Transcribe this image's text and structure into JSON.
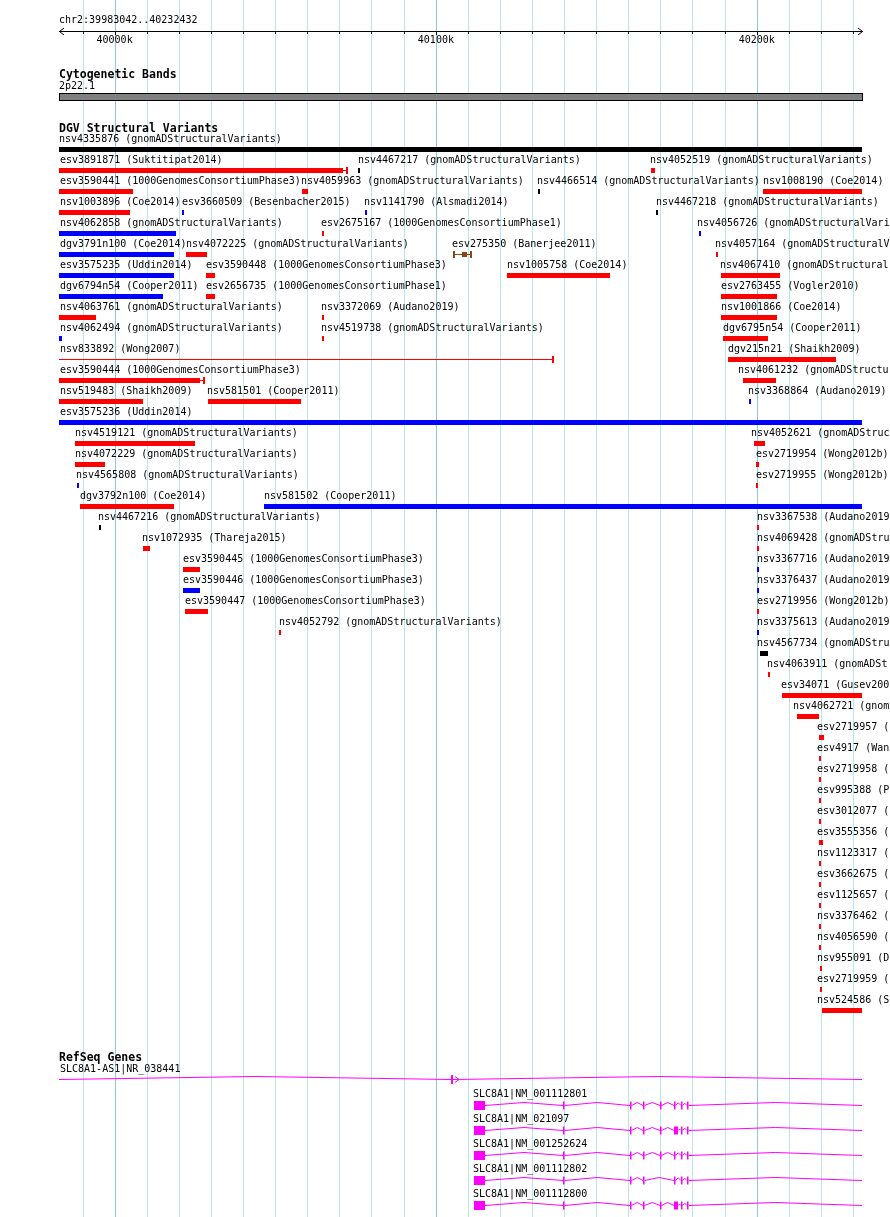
{
  "ruler": {
    "locus": "chr2:39983042..40232432",
    "ticks": [
      "40000k",
      "40100k",
      "40200k"
    ]
  },
  "cytoband_track": {
    "title": "Cytogenetic Bands",
    "band": "2p22.1"
  },
  "dgv_track": {
    "title": "DGV Structural Variants",
    "rows": [
      {
        "features": [
          {
            "label": "nsv4335876 (gnomADStructuralVariants)",
            "color": "#000000",
            "kind": "bar"
          }
        ]
      },
      {
        "features": [
          {
            "label": "esv3891871 (Suktitipat2014)",
            "color": "#ff0000",
            "kind": "bar-capped"
          },
          {
            "label": "nsv4467217 (gnomADStructuralVariants)",
            "color": "#000000",
            "kind": "bar"
          },
          {
            "label": "nsv4052519 (gnomADStructuralVariants)",
            "color": "#ff0000",
            "kind": "bar"
          }
        ]
      },
      {
        "features": [
          {
            "label": "esv3590441 (1000GenomesConsortiumPhase3)",
            "color": "#ff0000",
            "kind": "bar"
          },
          {
            "label": "nsv4059963 (gnomADStructuralVariants)",
            "color": "#ff0000",
            "kind": "bar"
          },
          {
            "label": "nsv4466514 (gnomADStructuralVariants)",
            "color": "#000000",
            "kind": "bar"
          },
          {
            "label": "nsv1008190 (Coe2014)",
            "color": "#ff0000",
            "kind": "bar"
          }
        ]
      },
      {
        "features": [
          {
            "label": "nsv1003896 (Coe2014)",
            "color": "#ff0000",
            "kind": "bar"
          },
          {
            "label": "esv3660509 (Besenbacher2015)",
            "color": "#0000ff",
            "kind": "bar"
          },
          {
            "label": "nsv1141790 (Alsmadi2014)",
            "color": "#0000ff",
            "kind": "bar"
          },
          {
            "label": "nsv4467218 (gnomADStructuralVariants)",
            "color": "#000000",
            "kind": "bar"
          }
        ]
      },
      {
        "features": [
          {
            "label": "nsv4062858 (gnomADStructuralVariants)",
            "color": "#0000ff",
            "kind": "bar"
          },
          {
            "label": "esv2675167 (1000GenomesConsortiumPhase1)",
            "color": "#ff0000",
            "kind": "bar"
          },
          {
            "label": "nsv4056726 (gnomADStructuralVari",
            "color": "#0000ff",
            "kind": "bar"
          }
        ]
      },
      {
        "features": [
          {
            "label": "dgv3791n100 (Coe2014)",
            "color": "#0000ff",
            "kind": "bar"
          },
          {
            "label": "nsv4072225 (gnomADStructuralVariants)",
            "color": "#ff0000",
            "kind": "bar"
          },
          {
            "label": "esv275350 (Banerjee2011)",
            "color": "#8b4513",
            "kind": "span-capped"
          },
          {
            "label": "nsv4057164 (gnomADStructuralV",
            "color": "#ff0000",
            "kind": "bar"
          }
        ]
      },
      {
        "features": [
          {
            "label": "esv3575235 (Uddin2014)",
            "color": "#0000ff",
            "kind": "bar"
          },
          {
            "label": "esv3590448 (1000GenomesConsortiumPhase3)",
            "color": "#ff0000",
            "kind": "bar"
          },
          {
            "label": "nsv1005758 (Coe2014)",
            "color": "#ff0000",
            "kind": "bar"
          },
          {
            "label": "nsv4067410 (gnomADStructural",
            "color": "#ff0000",
            "kind": "bar"
          }
        ]
      },
      {
        "features": [
          {
            "label": "dgv6794n54 (Cooper2011)",
            "color": "#0000ff",
            "kind": "bar"
          },
          {
            "label": "esv2656735 (1000GenomesConsortiumPhase1)",
            "color": "#ff0000",
            "kind": "bar"
          },
          {
            "label": "esv2763455 (Vogler2010)",
            "color": "#ff0000",
            "kind": "bar"
          }
        ]
      },
      {
        "features": [
          {
            "label": "nsv4063761 (gnomADStructuralVariants)",
            "color": "#ff0000",
            "kind": "bar"
          },
          {
            "label": "nsv3372069 (Audano2019)",
            "color": "#ff0000",
            "kind": "bar"
          },
          {
            "label": "nsv1001866 (Coe2014)",
            "color": "#ff0000",
            "kind": "bar"
          }
        ]
      },
      {
        "features": [
          {
            "label": "nsv4062494 (gnomADStructuralVariants)",
            "color": "#0000ff",
            "kind": "bar"
          },
          {
            "label": "nsv4519738 (gnomADStructuralVariants)",
            "color": "#ff0000",
            "kind": "bar"
          },
          {
            "label": "dgv6795n54 (Cooper2011)",
            "color": "#ff0000",
            "kind": "bar"
          }
        ]
      },
      {
        "features": [
          {
            "label": "nsv833892 (Wong2007)",
            "color": "#ff0000",
            "kind": "line-capped"
          },
          {
            "label": "dgv215n21 (Shaikh2009)",
            "color": "#ff0000",
            "kind": "bar"
          }
        ]
      },
      {
        "features": [
          {
            "label": "esv3590444 (1000GenomesConsortiumPhase3)",
            "color": "#ff0000",
            "kind": "bar-capped"
          },
          {
            "label": "nsv4061232 (gnomADStructu",
            "color": "#ff0000",
            "kind": "bar"
          }
        ]
      },
      {
        "features": [
          {
            "label": "nsv519483 (Shaikh2009)",
            "color": "#ff0000",
            "kind": "bar"
          },
          {
            "label": "nsv581501 (Cooper2011)",
            "color": "#ff0000",
            "kind": "bar"
          },
          {
            "label": "nsv3368864 (Audano2019)",
            "color": "#0000ff",
            "kind": "bar"
          }
        ]
      },
      {
        "features": [
          {
            "label": "esv3575236 (Uddin2014)",
            "color": "#0000ff",
            "kind": "bar"
          }
        ]
      },
      {
        "features": [
          {
            "label": "nsv4519121 (gnomADStructuralVariants)",
            "color": "#ff0000",
            "kind": "bar"
          },
          {
            "label": "nsv4052621 (gnomADStruc",
            "color": "#ff0000",
            "kind": "bar"
          }
        ]
      },
      {
        "features": [
          {
            "label": "nsv4072229 (gnomADStructuralVariants)",
            "color": "#ff0000",
            "kind": "bar"
          },
          {
            "label": "esv2719954 (Wong2012b)",
            "color": "#ff0000",
            "kind": "bar"
          }
        ]
      },
      {
        "features": [
          {
            "label": "nsv4565808 (gnomADStructuralVariants)",
            "color": "#0000ff",
            "kind": "bar"
          },
          {
            "label": "esv2719955 (Wong2012b)",
            "color": "#ff0000",
            "kind": "bar"
          }
        ]
      },
      {
        "features": [
          {
            "label": "dgv3792n100 (Coe2014)",
            "color": "#ff0000",
            "kind": "bar"
          },
          {
            "label": "nsv581502 (Cooper2011)",
            "color": "#0000ff",
            "kind": "bar"
          }
        ]
      },
      {
        "features": [
          {
            "label": "nsv4467216 (gnomADStructuralVariants)",
            "color": "#000000",
            "kind": "bar"
          },
          {
            "label": "nsv3367538 (Audano2019",
            "color": "#ff0000",
            "kind": "bar"
          }
        ]
      },
      {
        "features": [
          {
            "label": "nsv1072935 (Thareja2015)",
            "color": "#ff0000",
            "kind": "bar"
          },
          {
            "label": "nsv4069428 (gnomADStru",
            "color": "#ff0000",
            "kind": "bar"
          }
        ]
      },
      {
        "features": [
          {
            "label": "esv3590445 (1000GenomesConsortiumPhase3)",
            "color": "#ff0000",
            "kind": "bar"
          },
          {
            "label": "nsv3367716 (Audano2019",
            "color": "#0000ff",
            "kind": "bar"
          }
        ]
      },
      {
        "features": [
          {
            "label": "esv3590446 (1000GenomesConsortiumPhase3)",
            "color": "#0000ff",
            "kind": "bar"
          },
          {
            "label": "nsv3376437 (Audano2019",
            "color": "#0000ff",
            "kind": "bar"
          }
        ]
      },
      {
        "features": [
          {
            "label": "esv3590447 (1000GenomesConsortiumPhase3)",
            "color": "#ff0000",
            "kind": "bar"
          },
          {
            "label": "esv2719956 (Wong2012b)",
            "color": "#ff0000",
            "kind": "bar"
          }
        ]
      },
      {
        "features": [
          {
            "label": "nsv4052792 (gnomADStructuralVariants)",
            "color": "#ff0000",
            "kind": "bar"
          },
          {
            "label": "nsv3375613 (Audano2019",
            "color": "#0000ff",
            "kind": "bar"
          }
        ]
      },
      {
        "features": [
          {
            "label": "nsv4567734 (gnomADStru",
            "color": "#000000",
            "kind": "bar"
          }
        ]
      },
      {
        "features": [
          {
            "label": "nsv4063911 (gnomADSt",
            "color": "#ff0000",
            "kind": "bar"
          }
        ]
      },
      {
        "features": [
          {
            "label": "esv34071 (Gusev200",
            "color": "#ff0000",
            "kind": "bar"
          }
        ]
      },
      {
        "features": [
          {
            "label": "nsv4062721 (gnom",
            "color": "#ff0000",
            "kind": "bar"
          }
        ]
      },
      {
        "features": [
          {
            "label": "esv2719957 (",
            "color": "#ff0000",
            "kind": "bar"
          }
        ]
      },
      {
        "features": [
          {
            "label": "esv4917 (Wan",
            "color": "#ff0000",
            "kind": "bar"
          }
        ]
      },
      {
        "features": [
          {
            "label": "esv2719958 (",
            "color": "#ff0000",
            "kind": "bar"
          }
        ]
      },
      {
        "features": [
          {
            "label": "esv995388 (P",
            "color": "#ff0000",
            "kind": "bar"
          }
        ]
      },
      {
        "features": [
          {
            "label": "esv3012077 (",
            "color": "#ff0000",
            "kind": "bar"
          }
        ]
      },
      {
        "features": [
          {
            "label": "esv3555356 (",
            "color": "#ff0000",
            "kind": "bar"
          }
        ]
      },
      {
        "features": [
          {
            "label": "nsv1123317 (",
            "color": "#ff0000",
            "kind": "bar"
          }
        ]
      },
      {
        "features": [
          {
            "label": "esv3662675 (",
            "color": "#ff0000",
            "kind": "bar"
          }
        ]
      },
      {
        "features": [
          {
            "label": "esv1125657 (",
            "color": "#ff0000",
            "kind": "bar"
          }
        ]
      },
      {
        "features": [
          {
            "label": "nsv3376462 (",
            "color": "#ff0000",
            "kind": "bar"
          }
        ]
      },
      {
        "features": [
          {
            "label": "nsv4056590 (",
            "color": "#ff0000",
            "kind": "bar"
          }
        ]
      },
      {
        "features": [
          {
            "label": "nsv955091 (D",
            "color": "#ff0000",
            "kind": "bar"
          }
        ]
      },
      {
        "features": [
          {
            "label": "esv2719959 (",
            "color": "#ff0000",
            "kind": "bar"
          }
        ]
      },
      {
        "features": [
          {
            "label": "nsv524586 (S",
            "color": "#ff0000",
            "kind": "bar"
          }
        ]
      }
    ]
  },
  "refseq_track": {
    "title": "RefSeq Genes",
    "transcripts": [
      {
        "label": "SLC8A1-AS1|NR_038441"
      },
      {
        "label": "SLC8A1|NM_001112801"
      },
      {
        "label": "SLC8A1|NM_021097"
      },
      {
        "label": "SLC8A1|NM_001252624"
      },
      {
        "label": "SLC8A1|NM_001112802"
      },
      {
        "label": "SLC8A1|NM_001112800"
      }
    ]
  }
}
